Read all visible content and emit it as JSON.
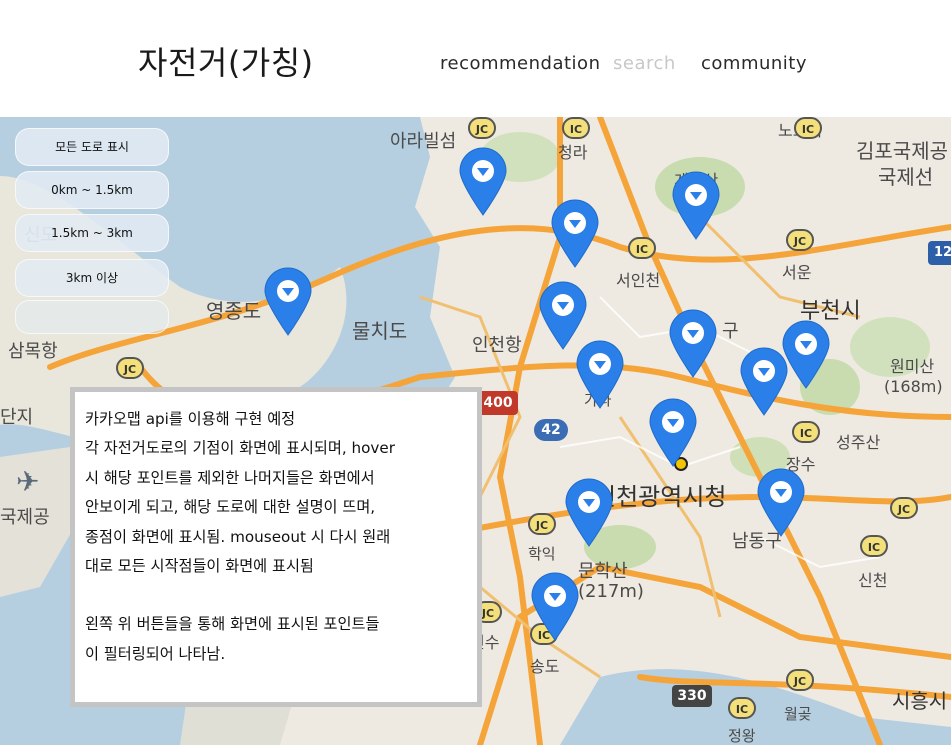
{
  "header": {
    "logo": "자전거(가칭)",
    "nav": [
      {
        "label": "recommendation",
        "active": false
      },
      {
        "label": "search",
        "active": true
      },
      {
        "label": "community",
        "active": false
      }
    ]
  },
  "filters": [
    {
      "label": "모든 도로 표시"
    },
    {
      "label": "0km ~ 1.5km"
    },
    {
      "label": "1.5km ~ 3km"
    },
    {
      "label": "3km 이상"
    },
    {
      "label": ""
    }
  ],
  "description": {
    "lines": [
      "카카오맵 api를 이용해 구현 예정",
      "각 자전거도로의 기점이 화면에 표시되며, hover",
      "시 해당 포인트를 제외한 나머지들은 화면에서",
      "안보이게 되고, 해당 도로에 대한 설명이 뜨며,",
      "종점이 화면에 표시됨. mouseout 시 다시 원래",
      "대로 모든 시작점들이 화면에 표시됨"
    ],
    "lines2": [
      "왼쪽 위 버튼들을 통해 화면에 표시된 포인트들",
      "이 필터링되어 나타남."
    ]
  },
  "map_labels": [
    {
      "text": "아라빌섬"
    },
    {
      "text": "청라"
    },
    {
      "text": "노오지"
    },
    {
      "text": "김포국제공"
    },
    {
      "text": "국제선"
    },
    {
      "text": "계양산"
    },
    {
      "text": "서인천"
    },
    {
      "text": "서운"
    },
    {
      "text": "부천시"
    },
    {
      "text": "영종도"
    },
    {
      "text": "물치도"
    },
    {
      "text": "인천항"
    },
    {
      "text": "삼목항"
    },
    {
      "text": "원미산"
    },
    {
      "text": "(168m)"
    },
    {
      "text": "단지"
    },
    {
      "text": "성주산"
    },
    {
      "text": "장수"
    },
    {
      "text": "인천광역시청"
    },
    {
      "text": "남동구"
    },
    {
      "text": "신천"
    },
    {
      "text": "학익"
    },
    {
      "text": "문학산"
    },
    {
      "text": "(217m)"
    },
    {
      "text": "연수"
    },
    {
      "text": "송도"
    },
    {
      "text": "시흥시"
    },
    {
      "text": "월곶"
    },
    {
      "text": "정왕"
    },
    {
      "text": "국제공"
    },
    {
      "text": "신도"
    },
    {
      "text": "가좌"
    },
    {
      "text": "구"
    }
  ],
  "road_badges": [
    {
      "text": "400"
    },
    {
      "text": "42"
    },
    {
      "text": "330"
    },
    {
      "text": "12"
    }
  ],
  "ic_badges": [
    "JC",
    "IC",
    "IC",
    "JC",
    "JC",
    "JC",
    "IC",
    "IC",
    "IC",
    "JC",
    "IC",
    "JC",
    "IC",
    "JC"
  ],
  "colors": {
    "pin": "#2b7fe8",
    "road_major": "#f5a43a",
    "water": "#b5cfe0",
    "land": "#eeeae2",
    "green": "#c8dcb0"
  },
  "pins": [
    {
      "id": "pin-1"
    },
    {
      "id": "pin-2"
    },
    {
      "id": "pin-3"
    },
    {
      "id": "pin-4"
    },
    {
      "id": "pin-5"
    },
    {
      "id": "pin-6"
    },
    {
      "id": "pin-7"
    },
    {
      "id": "pin-8"
    },
    {
      "id": "pin-9"
    },
    {
      "id": "pin-10"
    },
    {
      "id": "pin-11"
    },
    {
      "id": "pin-12"
    },
    {
      "id": "pin-13"
    },
    {
      "id": "pin-14"
    }
  ]
}
